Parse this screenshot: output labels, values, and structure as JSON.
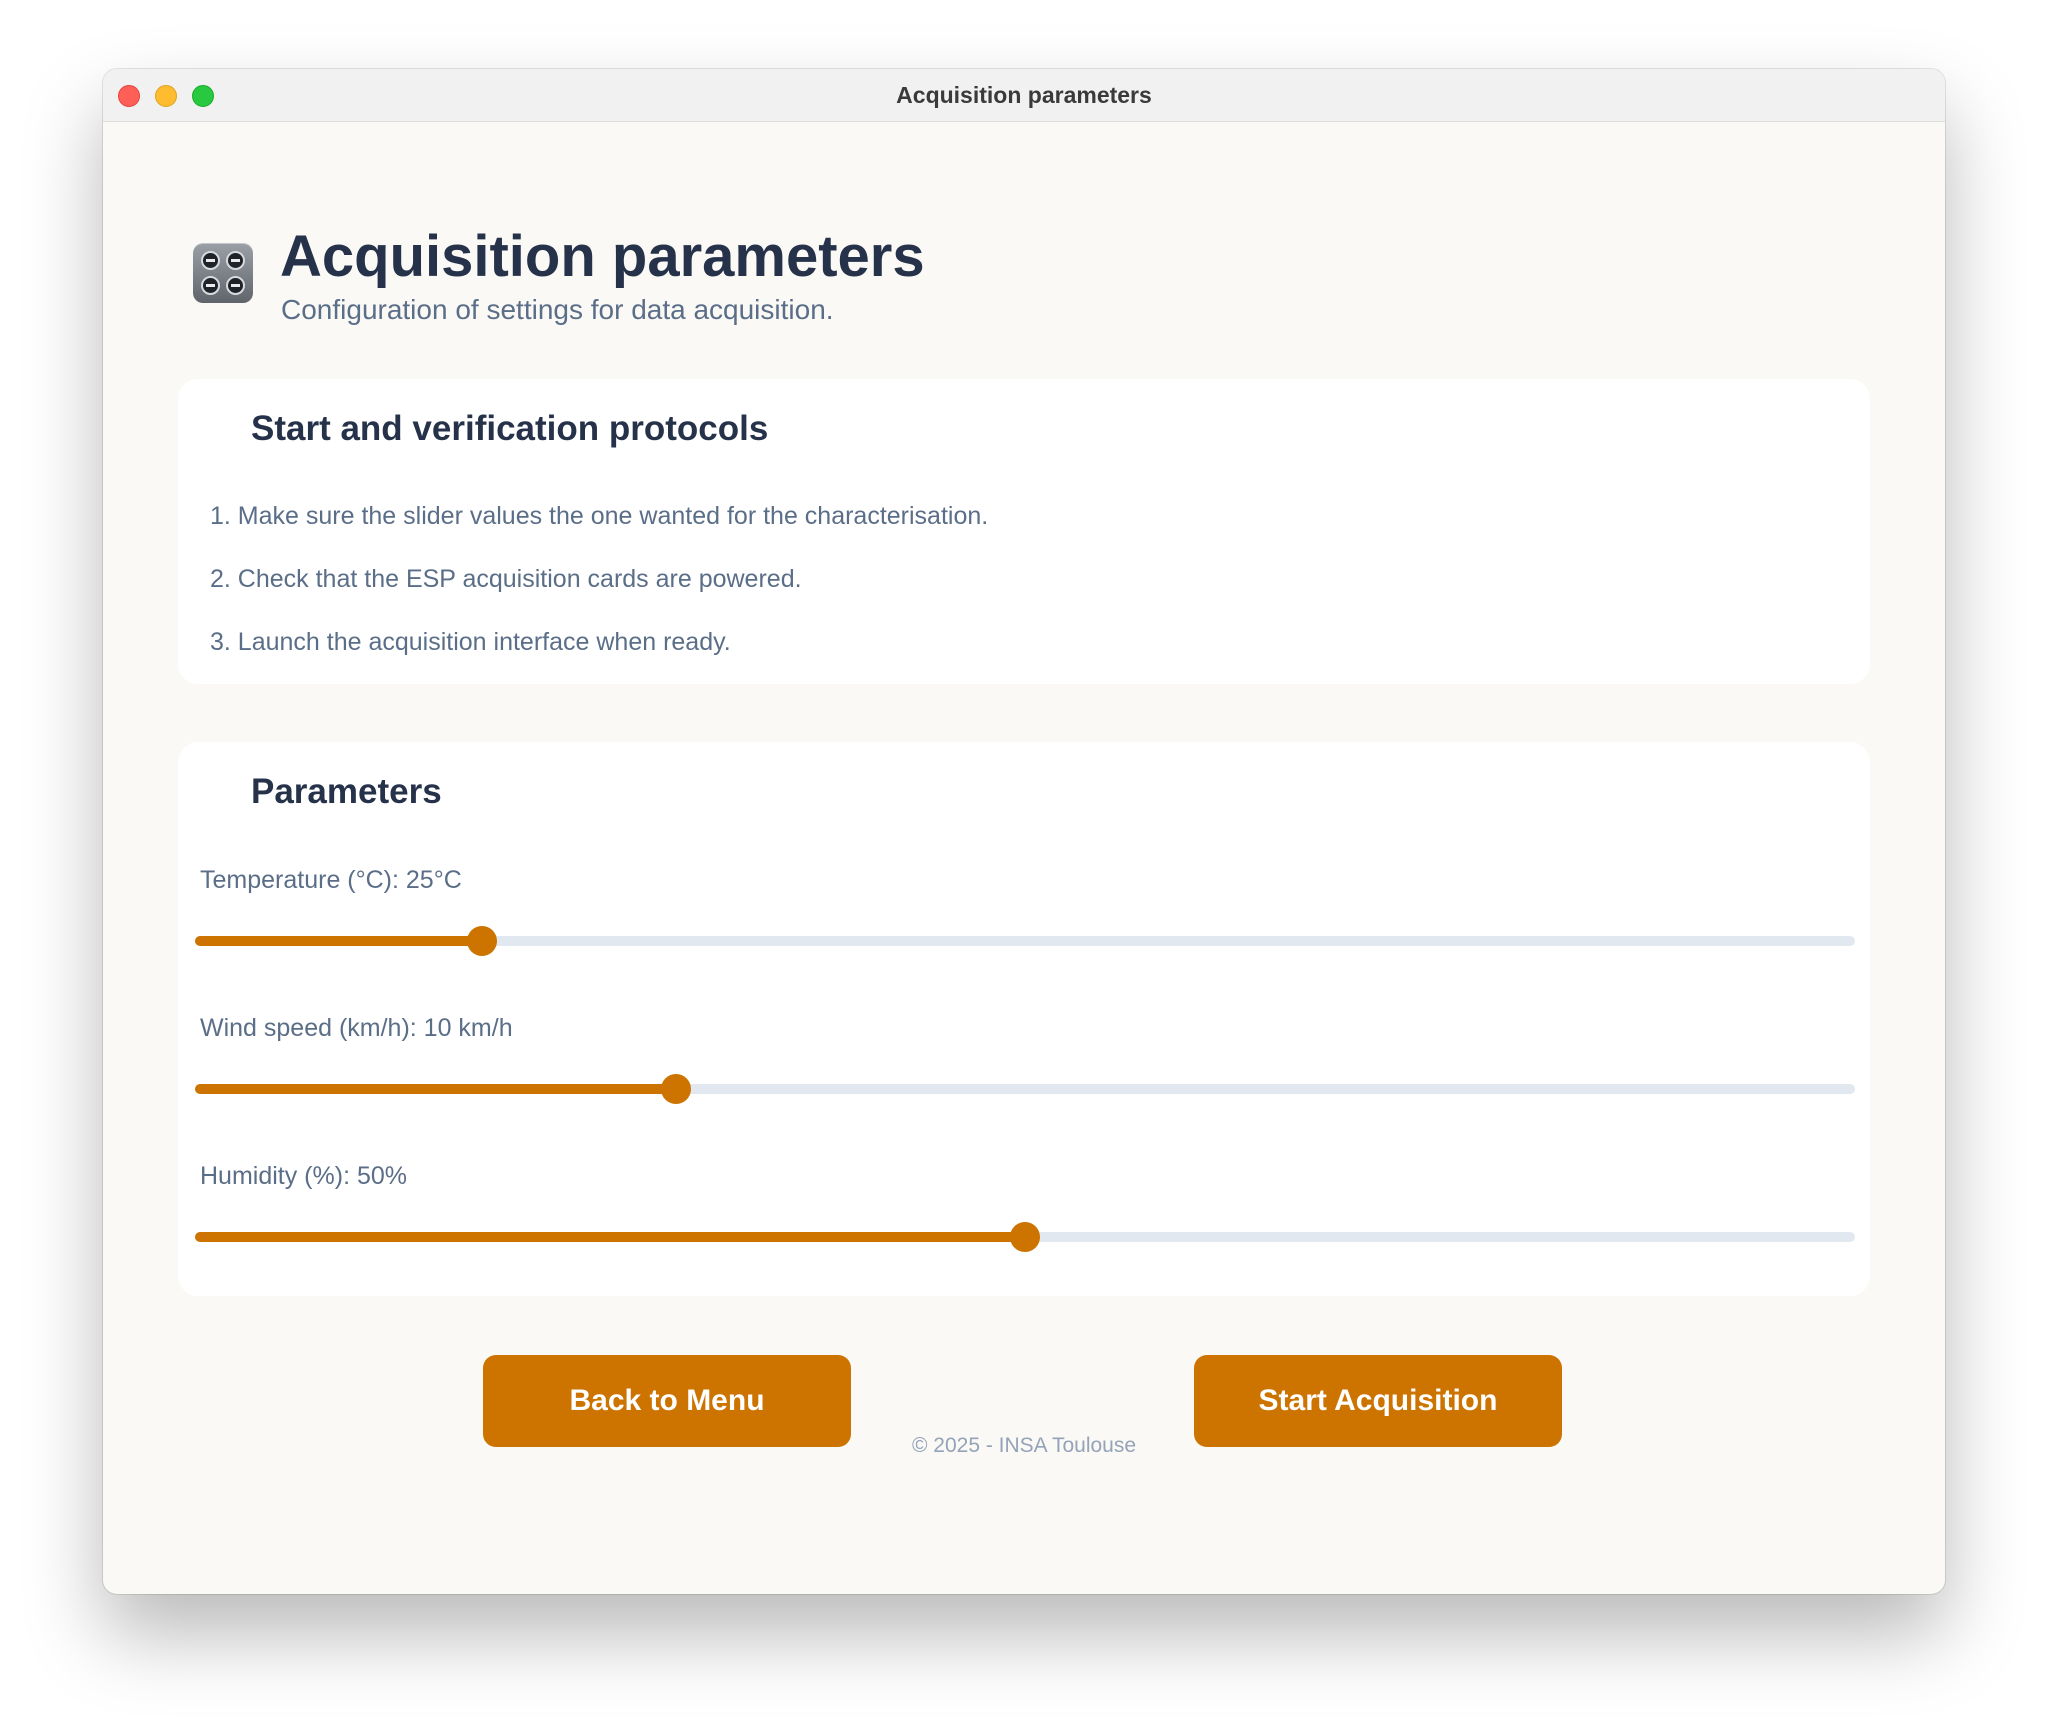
{
  "window": {
    "title": "Acquisition parameters"
  },
  "header": {
    "icon": "control-knobs-icon",
    "title": "Acquisition parameters",
    "subtitle": "Configuration of settings for data acquisition."
  },
  "protocols": {
    "title": "Start and verification protocols",
    "steps": [
      "1. Make sure the slider values the one wanted for the characterisation.",
      "2. Check that the ESP acquisition cards are powered.",
      "3. Launch the acquisition interface when ready."
    ]
  },
  "parameters": {
    "title": "Parameters",
    "sliders": [
      {
        "label": "Temperature (°C): 25°C",
        "value": 25,
        "fraction": 0.173
      },
      {
        "label": "Wind speed (km/h): 10 km/h",
        "value": 10,
        "fraction": 0.29
      },
      {
        "label": "Humidity (%): 50%",
        "value": 50,
        "fraction": 0.5
      }
    ]
  },
  "buttons": {
    "back": "Back to Menu",
    "start": "Start Acquisition"
  },
  "footer": {
    "text": "© 2025 - INSA Toulouse"
  },
  "colors": {
    "accent": "#cc7300",
    "track": "#e2e8f0",
    "heading": "#26324a",
    "text": "#5b6e88",
    "footer": "#94a3b8",
    "background": "#faf9f6"
  }
}
